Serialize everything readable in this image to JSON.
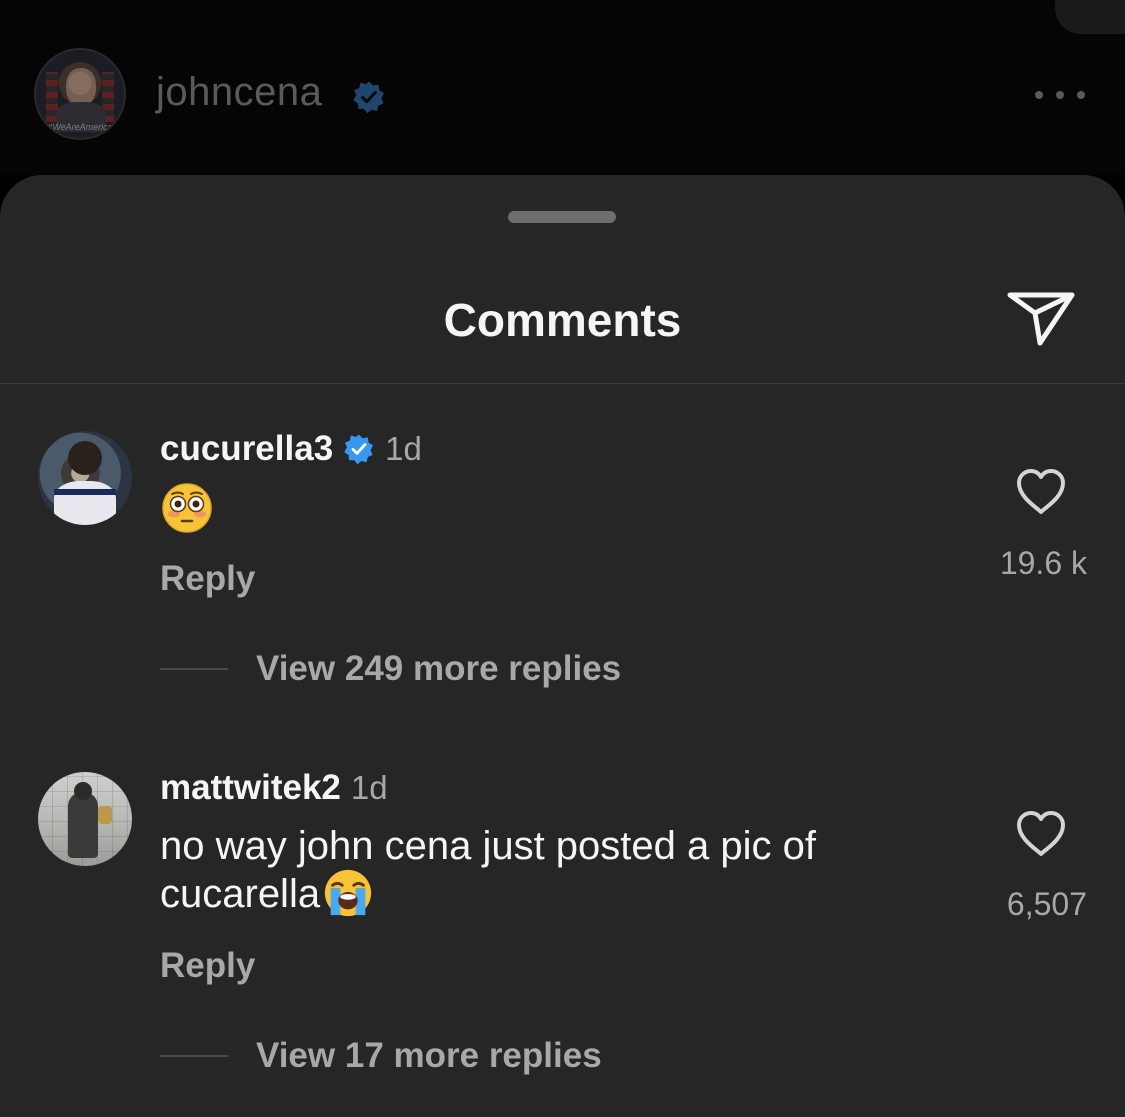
{
  "post_header": {
    "username": "johncena",
    "avatar_caption": "#WeAreAmerica"
  },
  "sheet": {
    "title": "Comments"
  },
  "comments": [
    {
      "username": "cucurella3",
      "verified": true,
      "time": "1d",
      "text": "",
      "emoji": "flushed-face",
      "reply_label": "Reply",
      "likes": "19.6 k",
      "view_replies": "View 249 more replies"
    },
    {
      "username": "mattwitek2",
      "verified": false,
      "time": "1d",
      "text_line1": "no way john cena just posted a pic of",
      "text_line2": "cucarella",
      "emoji": "loudly-crying-face",
      "reply_label": "Reply",
      "likes": "6,507",
      "view_replies": "View 17 more replies"
    }
  ],
  "colors": {
    "sheet_bg": "#262626",
    "verified_blue": "#3897f0",
    "muted_text": "#a8a8a8",
    "primary_text": "#f5f5f5"
  },
  "icons": [
    "verified-badge-icon",
    "more-options-icon",
    "share-send-icon",
    "heart-icon",
    "flushed-face-emoji",
    "loudly-crying-face-emoji"
  ]
}
